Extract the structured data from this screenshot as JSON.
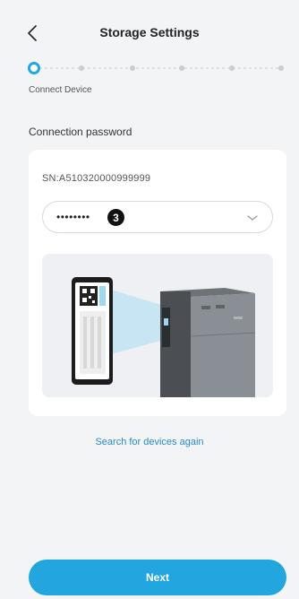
{
  "header": {
    "title": "Storage Settings"
  },
  "stepper": {
    "current_label": "Connect Device",
    "total_steps": 6,
    "current_step": 1
  },
  "section": {
    "title": "Connection password"
  },
  "device": {
    "sn": "SN:A510320000999999"
  },
  "password": {
    "value": "••••••••"
  },
  "badge": {
    "text": "3"
  },
  "actions": {
    "search_again": "Search for devices again",
    "next": "Next"
  },
  "colors": {
    "accent": "#23a6e0",
    "link": "#2a8ac8",
    "background": "#f3f4f6"
  }
}
